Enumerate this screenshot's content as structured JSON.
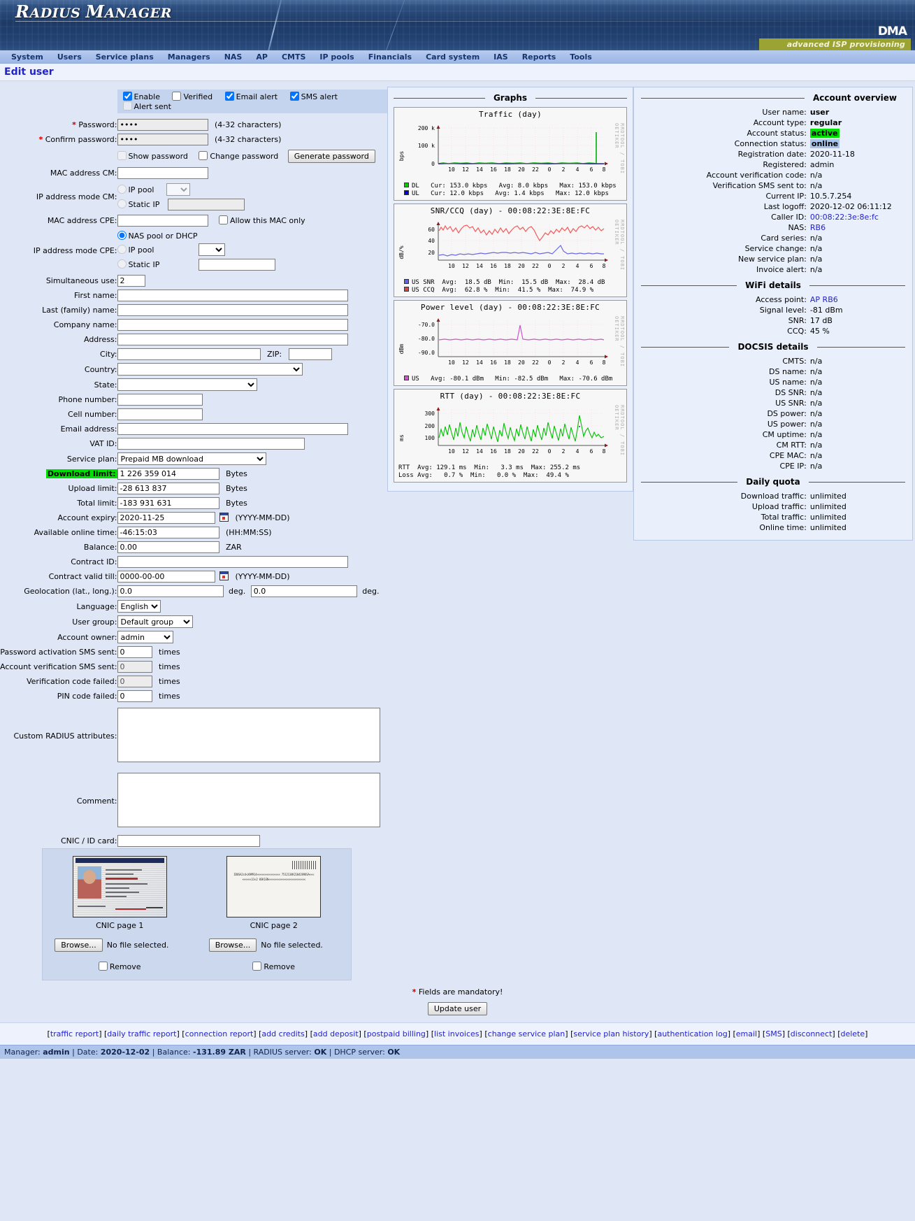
{
  "app": {
    "logo_r": "R",
    "logo_adius": "ADIUS",
    "logo_m": "M",
    "logo_anager": "ANAGER",
    "brand_mark": "DMA",
    "brand_tagline": "advanced ISP provisioning"
  },
  "nav": {
    "items": [
      {
        "label": "System"
      },
      {
        "label": "Users"
      },
      {
        "label": "Service plans"
      },
      {
        "label": "Managers"
      },
      {
        "label": "NAS"
      },
      {
        "label": "AP"
      },
      {
        "label": "CMTS"
      },
      {
        "label": "IP pools"
      },
      {
        "label": "Financials"
      },
      {
        "label": "Card system"
      },
      {
        "label": "IAS"
      },
      {
        "label": "Reports"
      },
      {
        "label": "Tools"
      }
    ]
  },
  "page": {
    "title": "Edit user"
  },
  "toggles": {
    "enable": "Enable",
    "verified": "Verified",
    "email_alert": "Email alert",
    "sms_alert": "SMS alert",
    "alert_sent": "Alert sent"
  },
  "form": {
    "password_label": "Password:",
    "password_value": "••••",
    "password_hint": "(4-32 characters)",
    "confirm_label": "Confirm password:",
    "confirm_value": "••••",
    "confirm_hint": "(4-32 characters)",
    "show_password": "Show password",
    "change_password": "Change password",
    "generate_password": "Generate password",
    "mac_cm_label": "MAC address CM:",
    "mac_cm_value": "",
    "ip_mode_cm_label": "IP address mode CM:",
    "ip_pool": "IP pool",
    "static_ip": "Static IP",
    "ip_cm_pool_value": "",
    "ip_cm_static_value": "",
    "mac_cpe_label": "MAC address CPE:",
    "mac_cpe_value": "",
    "allow_this_mac_only": "Allow this MAC only",
    "ip_mode_cpe_label": "IP address mode CPE:",
    "nas_pool_or_dhcp": "NAS pool or DHCP",
    "ip_cpe_pool_value": "",
    "ip_cpe_static_value": "",
    "sim_use_label": "Simultaneous use:",
    "sim_use_value": "2",
    "first_name_label": "First name:",
    "first_name_value": "",
    "last_name_label": "Last (family) name:",
    "last_name_value": "",
    "company_label": "Company name:",
    "company_value": "",
    "address_label": "Address:",
    "address_value": "",
    "city_label": "City:",
    "city_value": "",
    "zip_label": "ZIP:",
    "zip_value": "",
    "country_label": "Country:",
    "country_value": "",
    "state_label": "State:",
    "state_value": "",
    "phone_label": "Phone number:",
    "phone_value": "",
    "cell_label": "Cell number:",
    "cell_value": "",
    "email_label": "Email address:",
    "email_value": "",
    "vat_label": "VAT ID:",
    "vat_value": "",
    "service_plan_label": "Service plan:",
    "service_plan_value": "Prepaid MB download",
    "download_limit_label": "Download limit:",
    "download_limit_value": "1 226 359 014",
    "bytes": "Bytes",
    "upload_limit_label": "Upload limit:",
    "upload_limit_value": "-28 613 837",
    "total_limit_label": "Total limit:",
    "total_limit_value": "-183 931 631",
    "account_expiry_label": "Account expiry:",
    "account_expiry_value": "2020-11-25",
    "date_hint": "(YYYY-MM-DD)",
    "online_time_label": "Available online time:",
    "online_time_value": "-46:15:03",
    "time_hint": "(HH:MM:SS)",
    "balance_label": "Balance:",
    "balance_value": "0.00",
    "currency": "ZAR",
    "contract_id_label": "Contract ID:",
    "contract_id_value": "",
    "contract_till_label": "Contract valid till:",
    "contract_till_value": "0000-00-00",
    "geo_label": "Geolocation (lat., long.):",
    "geo_lat_value": "0.0",
    "geo_long_value": "0.0",
    "deg": "deg.",
    "language_label": "Language:",
    "language_value": "English",
    "user_group_label": "User group:",
    "user_group_value": "Default group",
    "account_owner_label": "Account owner:",
    "account_owner_value": "admin",
    "pw_sms_label": "Password activation SMS sent:",
    "pw_sms_value": "0",
    "times": "times",
    "acct_ver_sms_label": "Account verification SMS sent:",
    "acct_ver_sms_value": "0",
    "ver_code_failed_label": "Verification code failed:",
    "ver_code_failed_value": "0",
    "pin_failed_label": "PIN code failed:",
    "pin_failed_value": "0",
    "custom_radius_label": "Custom RADIUS attributes:",
    "custom_radius_value": "",
    "comment_label": "Comment:",
    "comment_value": "",
    "cnic_label": "CNIC / ID card:",
    "cnic_value": ""
  },
  "cnic": {
    "page1_caption": "CNIC page 1",
    "page2_caption": "CNIC page 2",
    "browse": "Browse...",
    "no_file": "No file selected.",
    "remove": "Remove",
    "mrz_text": "IBUSA2c4<XAM914<<<<<<<<<<<<<<< 7512134K2104289USA<<<<<<<<<11<2 0SK1EN<<<<<<<<<<<<<<<<<<<<<<<<"
  },
  "graphs": {
    "heading": "Graphs",
    "items": [
      {
        "title": "Traffic (day)",
        "ylabel": "bps",
        "yticks": [
          "200 k",
          "100 k",
          "0"
        ],
        "xticks": [
          "10",
          "12",
          "14",
          "16",
          "18",
          "20",
          "22",
          "0",
          "2",
          "4",
          "6",
          "8"
        ],
        "watermark": "RRDTOOL / TOBI OETIKER",
        "legend": [
          {
            "color": "#00cc00",
            "name": "DL",
            "cur_label": "Cur:",
            "cur": "153.0 kbps",
            "avg_label": "Avg:",
            "avg": "8.0 kbps",
            "max_label": "Max:",
            "max": "153.0 kbps"
          },
          {
            "color": "#0000e0",
            "name": "UL",
            "cur_label": "Cur:",
            "cur": "12.0 kbps",
            "avg_label": "Avg:",
            "avg": "1.4 kbps",
            "max_label": "Max:",
            "max": "12.0 kbps"
          }
        ]
      },
      {
        "title": "SNR/CCQ (day) - 00:08:22:3E:8E:FC",
        "ylabel": "dB/%",
        "yticks": [
          "60",
          "40",
          "20"
        ],
        "xticks": [
          "10",
          "12",
          "14",
          "16",
          "18",
          "20",
          "22",
          "0",
          "2",
          "4",
          "6",
          "8"
        ],
        "watermark": "RRDTOOL / TOBI OETIKER",
        "legend": [
          {
            "color": "#6060e0",
            "name": "US SNR",
            "cur_label": "Avg:",
            "cur": "18.5 dB",
            "avg_label": "Min:",
            "avg": "15.5 dB",
            "max_label": "Max:",
            "max": "28.4 dB"
          },
          {
            "color": "#e04040",
            "name": "US CCQ",
            "cur_label": "Avg:",
            "cur": "62.8 %",
            "avg_label": "Min:",
            "avg": "41.5 %",
            "max_label": "Max:",
            "max": "74.9 %"
          }
        ]
      },
      {
        "title": "Power level (day) - 00:08:22:3E:8E:FC",
        "ylabel": "dBm",
        "yticks": [
          "-70.0",
          "-80.0",
          "-90.0"
        ],
        "xticks": [
          "10",
          "12",
          "14",
          "16",
          "18",
          "20",
          "22",
          "0",
          "2",
          "4",
          "6",
          "8"
        ],
        "watermark": "RRDTOOL / TOBI OETIKER",
        "legend": [
          {
            "color": "#cc55cc",
            "name": "US",
            "cur_label": "Avg:",
            "cur": "-80.1 dBm",
            "avg_label": "Min:",
            "avg": "-82.5 dBm",
            "max_label": "Max:",
            "max": "-70.6 dBm"
          }
        ]
      },
      {
        "title": "RTT (day) - 00:08:22:3E:8E:FC",
        "ylabel": "ms",
        "yticks": [
          "300",
          "200",
          "100"
        ],
        "xticks": [
          "10",
          "12",
          "14",
          "16",
          "18",
          "20",
          "22",
          "0",
          "2",
          "4",
          "6",
          "8"
        ],
        "watermark": "RRDTOOL / TOBI OETIKER",
        "legend": [
          {
            "color": "#00cc00",
            "name": "RTT",
            "cur_label": "Avg:",
            "cur": "129.1 ms",
            "avg_label": "Min:",
            "avg": "3.3 ms",
            "max_label": "Max:",
            "max": "255.2 ms"
          },
          {
            "color": "#7755cc",
            "name": "Loss",
            "cur_label": "Avg:",
            "cur": "0.7 %",
            "avg_label": "Min:",
            "avg": "0.0 %",
            "max_label": "Max:",
            "max": "49.4 %"
          }
        ]
      }
    ]
  },
  "account": {
    "heading": "Account overview",
    "rows": [
      {
        "k": "User name:",
        "v": "user",
        "style": "bold"
      },
      {
        "k": "Account type:",
        "v": "regular",
        "style": "bold"
      },
      {
        "k": "Account status:",
        "v": "active",
        "style": "green"
      },
      {
        "k": "Connection status:",
        "v": "online",
        "style": "blue"
      },
      {
        "k": "Registration date:",
        "v": "2020-11-18",
        "style": ""
      },
      {
        "k": "Registered:",
        "v": "admin",
        "style": ""
      },
      {
        "k": "Account verification code:",
        "v": "n/a",
        "style": ""
      },
      {
        "k": "Verification SMS sent to:",
        "v": "n/a",
        "style": ""
      },
      {
        "k": "Current IP:",
        "v": "10.5.7.254",
        "style": ""
      },
      {
        "k": "Last logoff:",
        "v": "2020-12-02 06:11:12",
        "style": ""
      },
      {
        "k": "Caller ID:",
        "v": "00:08:22:3e:8e:fc",
        "style": "link"
      },
      {
        "k": "NAS:",
        "v": "RB6",
        "style": "link"
      },
      {
        "k": "Card series:",
        "v": "n/a",
        "style": ""
      },
      {
        "k": "Service change:",
        "v": "n/a",
        "style": ""
      },
      {
        "k": "New service plan:",
        "v": "n/a",
        "style": ""
      },
      {
        "k": "Invoice alert:",
        "v": "n/a",
        "style": ""
      }
    ],
    "wifi_heading": "WiFi details",
    "wifi_rows": [
      {
        "k": "Access point:",
        "v": "AP RB6",
        "style": "link"
      },
      {
        "k": "Signal level:",
        "v": "-81 dBm",
        "style": ""
      },
      {
        "k": "SNR:",
        "v": "17 dB",
        "style": ""
      },
      {
        "k": "CCQ:",
        "v": "45 %",
        "style": ""
      }
    ],
    "docsis_heading": "DOCSIS details",
    "docsis_rows": [
      {
        "k": "CMTS:",
        "v": "n/a",
        "style": ""
      },
      {
        "k": "DS name:",
        "v": "n/a",
        "style": ""
      },
      {
        "k": "US name:",
        "v": "n/a",
        "style": ""
      },
      {
        "k": "DS SNR:",
        "v": "n/a",
        "style": ""
      },
      {
        "k": "US SNR:",
        "v": "n/a",
        "style": ""
      },
      {
        "k": "DS power:",
        "v": "n/a",
        "style": ""
      },
      {
        "k": "US power:",
        "v": "n/a",
        "style": ""
      },
      {
        "k": "CM uptime:",
        "v": "n/a",
        "style": ""
      },
      {
        "k": "CM RTT:",
        "v": "n/a",
        "style": ""
      },
      {
        "k": "CPE MAC:",
        "v": "n/a",
        "style": ""
      },
      {
        "k": "CPE IP:",
        "v": "n/a",
        "style": ""
      }
    ],
    "quota_heading": "Daily quota",
    "quota_rows": [
      {
        "k": "Download traffic:",
        "v": "unlimited",
        "style": ""
      },
      {
        "k": "Upload traffic:",
        "v": "unlimited",
        "style": ""
      },
      {
        "k": "Total traffic:",
        "v": "unlimited",
        "style": ""
      },
      {
        "k": "Online time:",
        "v": "unlimited",
        "style": ""
      }
    ]
  },
  "footer": {
    "mandatory_star": "*",
    "mandatory_text": "Fields are mandatory!",
    "update_button": "Update user",
    "links": [
      "traffic report",
      "daily traffic report",
      "connection report",
      "add credits",
      "add deposit",
      "postpaid billing",
      "list invoices",
      "change service plan",
      "service plan history",
      "authentication log",
      "email",
      "SMS",
      "disconnect",
      "delete"
    ],
    "status": {
      "manager_label": "Manager:",
      "manager": "admin",
      "date_label": "Date:",
      "date": "2020-12-02",
      "balance_label": "Balance:",
      "balance": "-131.89 ZAR",
      "radius_label": "RADIUS server:",
      "radius": "OK",
      "dhcp_label": "DHCP server:",
      "dhcp": "OK",
      "sep": "|"
    }
  }
}
